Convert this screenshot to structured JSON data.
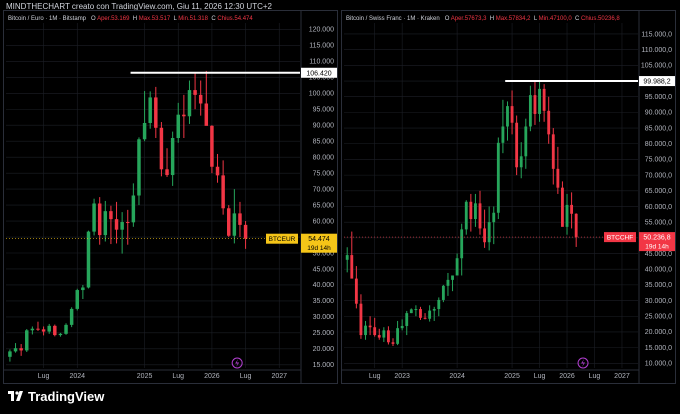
{
  "header": {
    "text": "MINDTHECHART creato con TradingView.com, Giu 11, 2026 12:30 UTC+2"
  },
  "footer": {
    "brand": "TradingView"
  },
  "colors": {
    "up": "#26a65b",
    "down": "#f23645",
    "grid": "#1c1f26",
    "text": "#b2b5be"
  },
  "chart_data": [
    {
      "type": "candlestick",
      "title": "Bitcoin / Euro · 1M · Bitstamp",
      "ohlc": {
        "O_label": "O",
        "O": "Aper.53.169",
        "H_label": "H",
        "H": "Max.53.517",
        "L_label": "L",
        "L": "Min.51.318",
        "C_label": "C",
        "C": "Chius.54.474"
      },
      "symbol": "BTCEUR",
      "last_price": "54.474",
      "countdown": "19d 14h",
      "resistance_label": "106.420",
      "resistance": 106420,
      "ylim": [
        14000,
        122000
      ],
      "y_ticks": [
        "15.000",
        "20.000",
        "25.000",
        "30.000",
        "35.000",
        "40.000",
        "45.000",
        "50.000",
        "55.000",
        "60.000",
        "65.000",
        "70.000",
        "75.000",
        "80.000",
        "85.000",
        "90.000",
        "95.000",
        "100.000",
        "105.000",
        "110.000",
        "115.000",
        "120.000"
      ],
      "y_tick_values": [
        15000,
        20000,
        25000,
        30000,
        35000,
        40000,
        45000,
        50000,
        55000,
        60000,
        65000,
        70000,
        75000,
        80000,
        85000,
        90000,
        95000,
        100000,
        105000,
        110000,
        115000,
        120000
      ],
      "x_ticks": [
        "Lug",
        "2024",
        "2025",
        "Lug",
        "2026",
        "Lug",
        "2027"
      ],
      "x_tick_months": [
        6,
        12,
        24,
        30,
        36,
        42,
        48
      ],
      "month_range": [
        -0.7,
        51.7
      ],
      "resistance_start_month": 21.5,
      "candles": [
        [
          17500,
          19800,
          16000,
          19200
        ],
        [
          19200,
          21800,
          18800,
          20200
        ],
        [
          20200,
          21500,
          17800,
          19500
        ],
        [
          19500,
          26200,
          19000,
          25800
        ],
        [
          25800,
          27000,
          24500,
          26300
        ],
        [
          26300,
          28500,
          25600,
          26100
        ],
        [
          26100,
          27000,
          24200,
          25400
        ],
        [
          25400,
          27800,
          24700,
          27200
        ],
        [
          27200,
          27600,
          23900,
          24300
        ],
        [
          24300,
          25000,
          23800,
          24700
        ],
        [
          24700,
          28000,
          24400,
          27500
        ],
        [
          27500,
          33000,
          26800,
          32500
        ],
        [
          32500,
          38800,
          32000,
          38400
        ],
        [
          38400,
          40000,
          35600,
          39200
        ],
        [
          39200,
          57000,
          38900,
          56700
        ],
        [
          56700,
          67000,
          55500,
          65500
        ],
        [
          65500,
          67500,
          52600,
          55600
        ],
        [
          55600,
          66300,
          53600,
          63100
        ],
        [
          63100,
          64800,
          52800,
          60600
        ],
        [
          60600,
          66000,
          53000,
          57300
        ],
        [
          57300,
          62800,
          49800,
          59700
        ],
        [
          59700,
          63500,
          52600,
          59600
        ],
        [
          59600,
          71800,
          58200,
          68000
        ],
        [
          68000,
          86200,
          65000,
          85600
        ],
        [
          85600,
          100700,
          85000,
          90700
        ],
        [
          90700,
          100600,
          88900,
          98700
        ],
        [
          98700,
          102000,
          86000,
          89200
        ],
        [
          89200,
          91000,
          74000,
          76200
        ],
        [
          76200,
          82800,
          73800,
          74400
        ],
        [
          74400,
          88000,
          71000,
          86000
        ],
        [
          86000,
          97000,
          84500,
          93300
        ],
        [
          93300,
          99500,
          86000,
          92800
        ],
        [
          92800,
          104000,
          90400,
          101000
        ],
        [
          101000,
          106400,
          95000,
          99500
        ],
        [
          99500,
          104000,
          93000,
          96800
        ],
        [
          96800,
          107000,
          94200,
          89800
        ],
        [
          89800,
          90000,
          75000,
          77000
        ],
        [
          77000,
          81000,
          72000,
          74300
        ],
        [
          74300,
          79000,
          62000,
          64000
        ],
        [
          64000,
          65000,
          55000,
          55400
        ],
        [
          55400,
          70000,
          53000,
          62400
        ],
        [
          62400,
          66000,
          55000,
          58800
        ],
        [
          58800,
          60000,
          51300,
          54474
        ]
      ]
    },
    {
      "type": "candlestick",
      "title": "Bitcoin / Swiss Franc · 1M · Kraken",
      "ohlc": {
        "O_label": "O",
        "O": "Aper.57673,3",
        "H_label": "H",
        "H": "Max.57834,2",
        "L_label": "L",
        "L": "Min.47100,0",
        "C_label": "C",
        "C": "Chius.50236,8"
      },
      "symbol": "BTCCHF",
      "last_price": "50.236,8",
      "countdown": "19d 14h",
      "resistance_label": "99.988,2",
      "resistance": 99988.2,
      "ylim": [
        8500,
        118500
      ],
      "y_ticks": [
        "10.000,0",
        "15.000,0",
        "20.000,0",
        "25.000,0",
        "30.000,0",
        "35.000,0",
        "40.000,0",
        "45.000,0",
        "50.000,0",
        "55.000,0",
        "60.000,0",
        "65.000,0",
        "70.000,0",
        "75.000,0",
        "80.000,0",
        "85.000,0",
        "90.000,0",
        "95.000,0",
        "100.000,0",
        "105.000,0",
        "110.000,0",
        "115.000,0"
      ],
      "y_tick_values": [
        10000,
        15000,
        20000,
        25000,
        30000,
        35000,
        40000,
        45000,
        50000,
        55000,
        60000,
        65000,
        70000,
        75000,
        80000,
        85000,
        90000,
        95000,
        100000,
        105000,
        110000,
        115000
      ],
      "x_ticks": [
        "Lug",
        "2023",
        "2024",
        "2025",
        "Lug",
        "2026",
        "Lug",
        "2027"
      ],
      "x_tick_months": [
        6,
        12,
        24,
        36,
        42,
        48,
        54,
        60
      ],
      "month_range": [
        -0.7,
        63.5
      ],
      "resistance_start_month": 34.5,
      "candles": [
        [
          43000,
          47000,
          39000,
          44500
        ],
        [
          44500,
          52000,
          43800,
          37000
        ],
        [
          37000,
          41000,
          27500,
          29000
        ],
        [
          29000,
          32000,
          17800,
          19000
        ],
        [
          19000,
          23500,
          17500,
          22000
        ],
        [
          22000,
          25000,
          19000,
          21500
        ],
        [
          21500,
          24500,
          18500,
          19000
        ],
        [
          19000,
          21000,
          17500,
          18200
        ],
        [
          18200,
          21500,
          16800,
          20500
        ],
        [
          20500,
          21800,
          16000,
          16700
        ],
        [
          16700,
          18000,
          15500,
          16200
        ],
        [
          16200,
          23500,
          15800,
          21200
        ],
        [
          21200,
          24000,
          20500,
          21900
        ],
        [
          21900,
          26700,
          19000,
          26000
        ],
        [
          26000,
          27500,
          26000,
          27200
        ],
        [
          27200,
          28500,
          25000,
          27300
        ],
        [
          27300,
          28000,
          23800,
          24500
        ],
        [
          24500,
          26000,
          24000,
          24200
        ],
        [
          24200,
          28500,
          23300,
          26800
        ],
        [
          26800,
          28000,
          23500,
          27300
        ],
        [
          27300,
          31000,
          25000,
          30200
        ],
        [
          30200,
          35000,
          29500,
          34700
        ],
        [
          34700,
          38800,
          31500,
          36600
        ],
        [
          36600,
          38000,
          33000,
          38000
        ],
        [
          38000,
          45000,
          38500,
          43500
        ],
        [
          43500,
          54500,
          38000,
          52700
        ],
        [
          52700,
          62000,
          51000,
          61500
        ],
        [
          61500,
          64000,
          52000,
          56000
        ],
        [
          56000,
          64000,
          53500,
          61000
        ],
        [
          61000,
          65000,
          51000,
          53000
        ],
        [
          53000,
          59000,
          46800,
          48600
        ],
        [
          48600,
          60000,
          46000,
          55000
        ],
        [
          55000,
          60000,
          48000,
          58000
        ],
        [
          58000,
          82000,
          56000,
          80300
        ],
        [
          80300,
          94000,
          77000,
          85500
        ],
        [
          85500,
          93500,
          81000,
          92000
        ],
        [
          92000,
          97000,
          83000,
          86700
        ],
        [
          86700,
          89000,
          70000,
          72500
        ],
        [
          72500,
          80500,
          69000,
          76000
        ],
        [
          76000,
          88000,
          72000,
          85500
        ],
        [
          85500,
          98500,
          84000,
          95500
        ],
        [
          95500,
          100000,
          86000,
          89500
        ],
        [
          89500,
          100000,
          87000,
          97500
        ],
        [
          97500,
          99000,
          87000,
          90500
        ],
        [
          90500,
          95000,
          80000,
          83000
        ],
        [
          83000,
          85000,
          67000,
          72000
        ],
        [
          72000,
          79000,
          64000,
          66000
        ],
        [
          66000,
          68000,
          55000,
          53500
        ],
        [
          53500,
          64000,
          51000,
          60500
        ],
        [
          60500,
          64500,
          53000,
          57673
        ],
        [
          57673,
          57834,
          47100,
          50236.8
        ]
      ]
    }
  ]
}
